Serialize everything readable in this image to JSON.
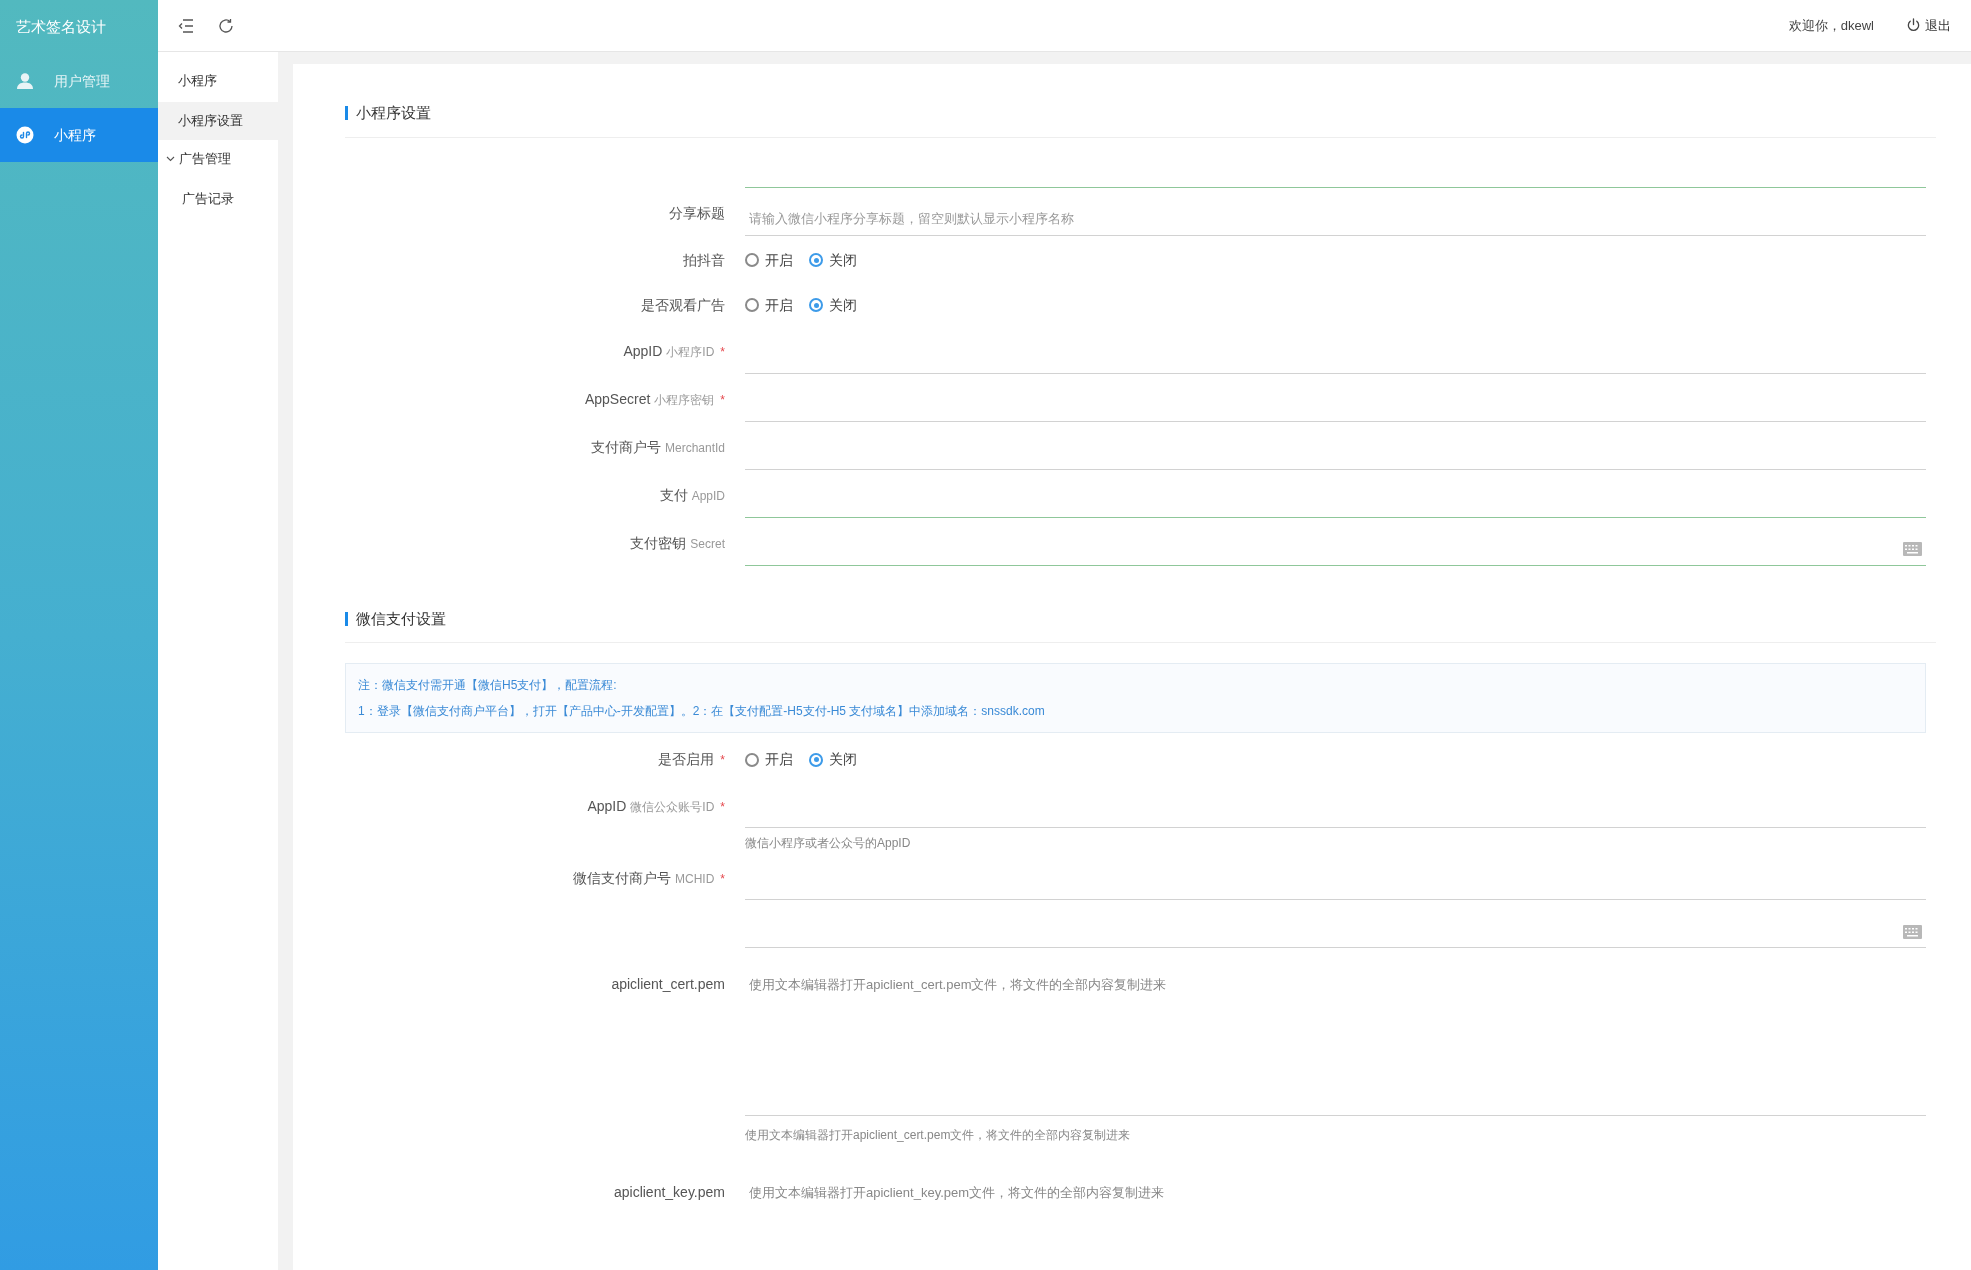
{
  "brand": "艺术签名设计",
  "sidebar": {
    "items": [
      {
        "label": "用户管理",
        "kind": "user",
        "selected": false
      },
      {
        "label": "小程序",
        "kind": "miniprogram",
        "selected": true
      }
    ]
  },
  "submenu": {
    "title": "小程序",
    "items": [
      {
        "label": "小程序设置",
        "selected": true
      },
      {
        "label": "广告管理",
        "selected": false,
        "expanded": true,
        "children": [
          {
            "label": "广告记录",
            "selected": false
          }
        ]
      }
    ]
  },
  "topbar": {
    "welcome": "欢迎你，dkewl",
    "logout": "退出"
  },
  "sections": [
    {
      "title": "小程序设置",
      "fields": [
        {
          "kind": "input",
          "highlighted": true
        },
        {
          "kind": "input",
          "label": "分享标题",
          "placeholder": "请输入微信小程序分享标题，留空则默认显示小程序名称",
          "highlighted": false
        },
        {
          "kind": "radio",
          "label": "拍抖音",
          "options": [
            {
              "label": "开启",
              "selected": false
            },
            {
              "label": "关闭",
              "selected": true
            }
          ]
        },
        {
          "kind": "radio",
          "label": "是否观看广告",
          "options": [
            {
              "label": "开启",
              "selected": false
            },
            {
              "label": "关闭",
              "selected": true
            }
          ]
        },
        {
          "kind": "input",
          "label": "AppID",
          "sub": "小程序ID",
          "mark": "*",
          "highlighted": false
        },
        {
          "kind": "input",
          "label": "AppSecret",
          "sub": "小程序密钥",
          "mark": "*",
          "highlighted": false
        },
        {
          "kind": "input",
          "label": "支付商户号",
          "sub": "MerchantId",
          "highlighted": false
        },
        {
          "kind": "input",
          "label": "支付",
          "sub": "AppID",
          "highlighted": true
        },
        {
          "kind": "secret",
          "label": "支付密钥",
          "sub": "Secret",
          "highlighted": true
        }
      ]
    },
    {
      "title": "微信支付设置",
      "notice": [
        "注：微信支付需开通【微信H5支付】，配置流程:",
        "1：登录【微信支付商户平台】，打开【产品中心-开发配置】。2：在【支付配置-H5支付-H5 支付域名】中添加域名：snssdk.com"
      ],
      "fields": [
        {
          "kind": "radio",
          "label": "是否启用",
          "mark": "*",
          "options": [
            {
              "label": "开启",
              "selected": false
            },
            {
              "label": "关闭",
              "selected": true
            }
          ]
        },
        {
          "kind": "input",
          "label": "AppID",
          "sub": "微信公众账号ID",
          "mark": "*",
          "help": "微信小程序或者公众号的AppID",
          "highlighted": false
        },
        {
          "kind": "input",
          "label": "微信支付商户号",
          "sub": "MCHID",
          "mark": "*",
          "highlighted": false
        },
        {
          "kind": "secret",
          "highlighted": false
        },
        {
          "kind": "textarea",
          "label": "apiclient_cert.pem",
          "placeholder": "使用文本编辑器打开apiclient_cert.pem文件，将文件的全部内容复制进来",
          "help": "使用文本编辑器打开apiclient_cert.pem文件，将文件的全部内容复制进来"
        },
        {
          "kind": "textarea",
          "label": "apiclient_key.pem",
          "placeholder": "使用文本编辑器打开apiclient_key.pem文件，将文件的全部内容复制进来"
        }
      ]
    }
  ]
}
